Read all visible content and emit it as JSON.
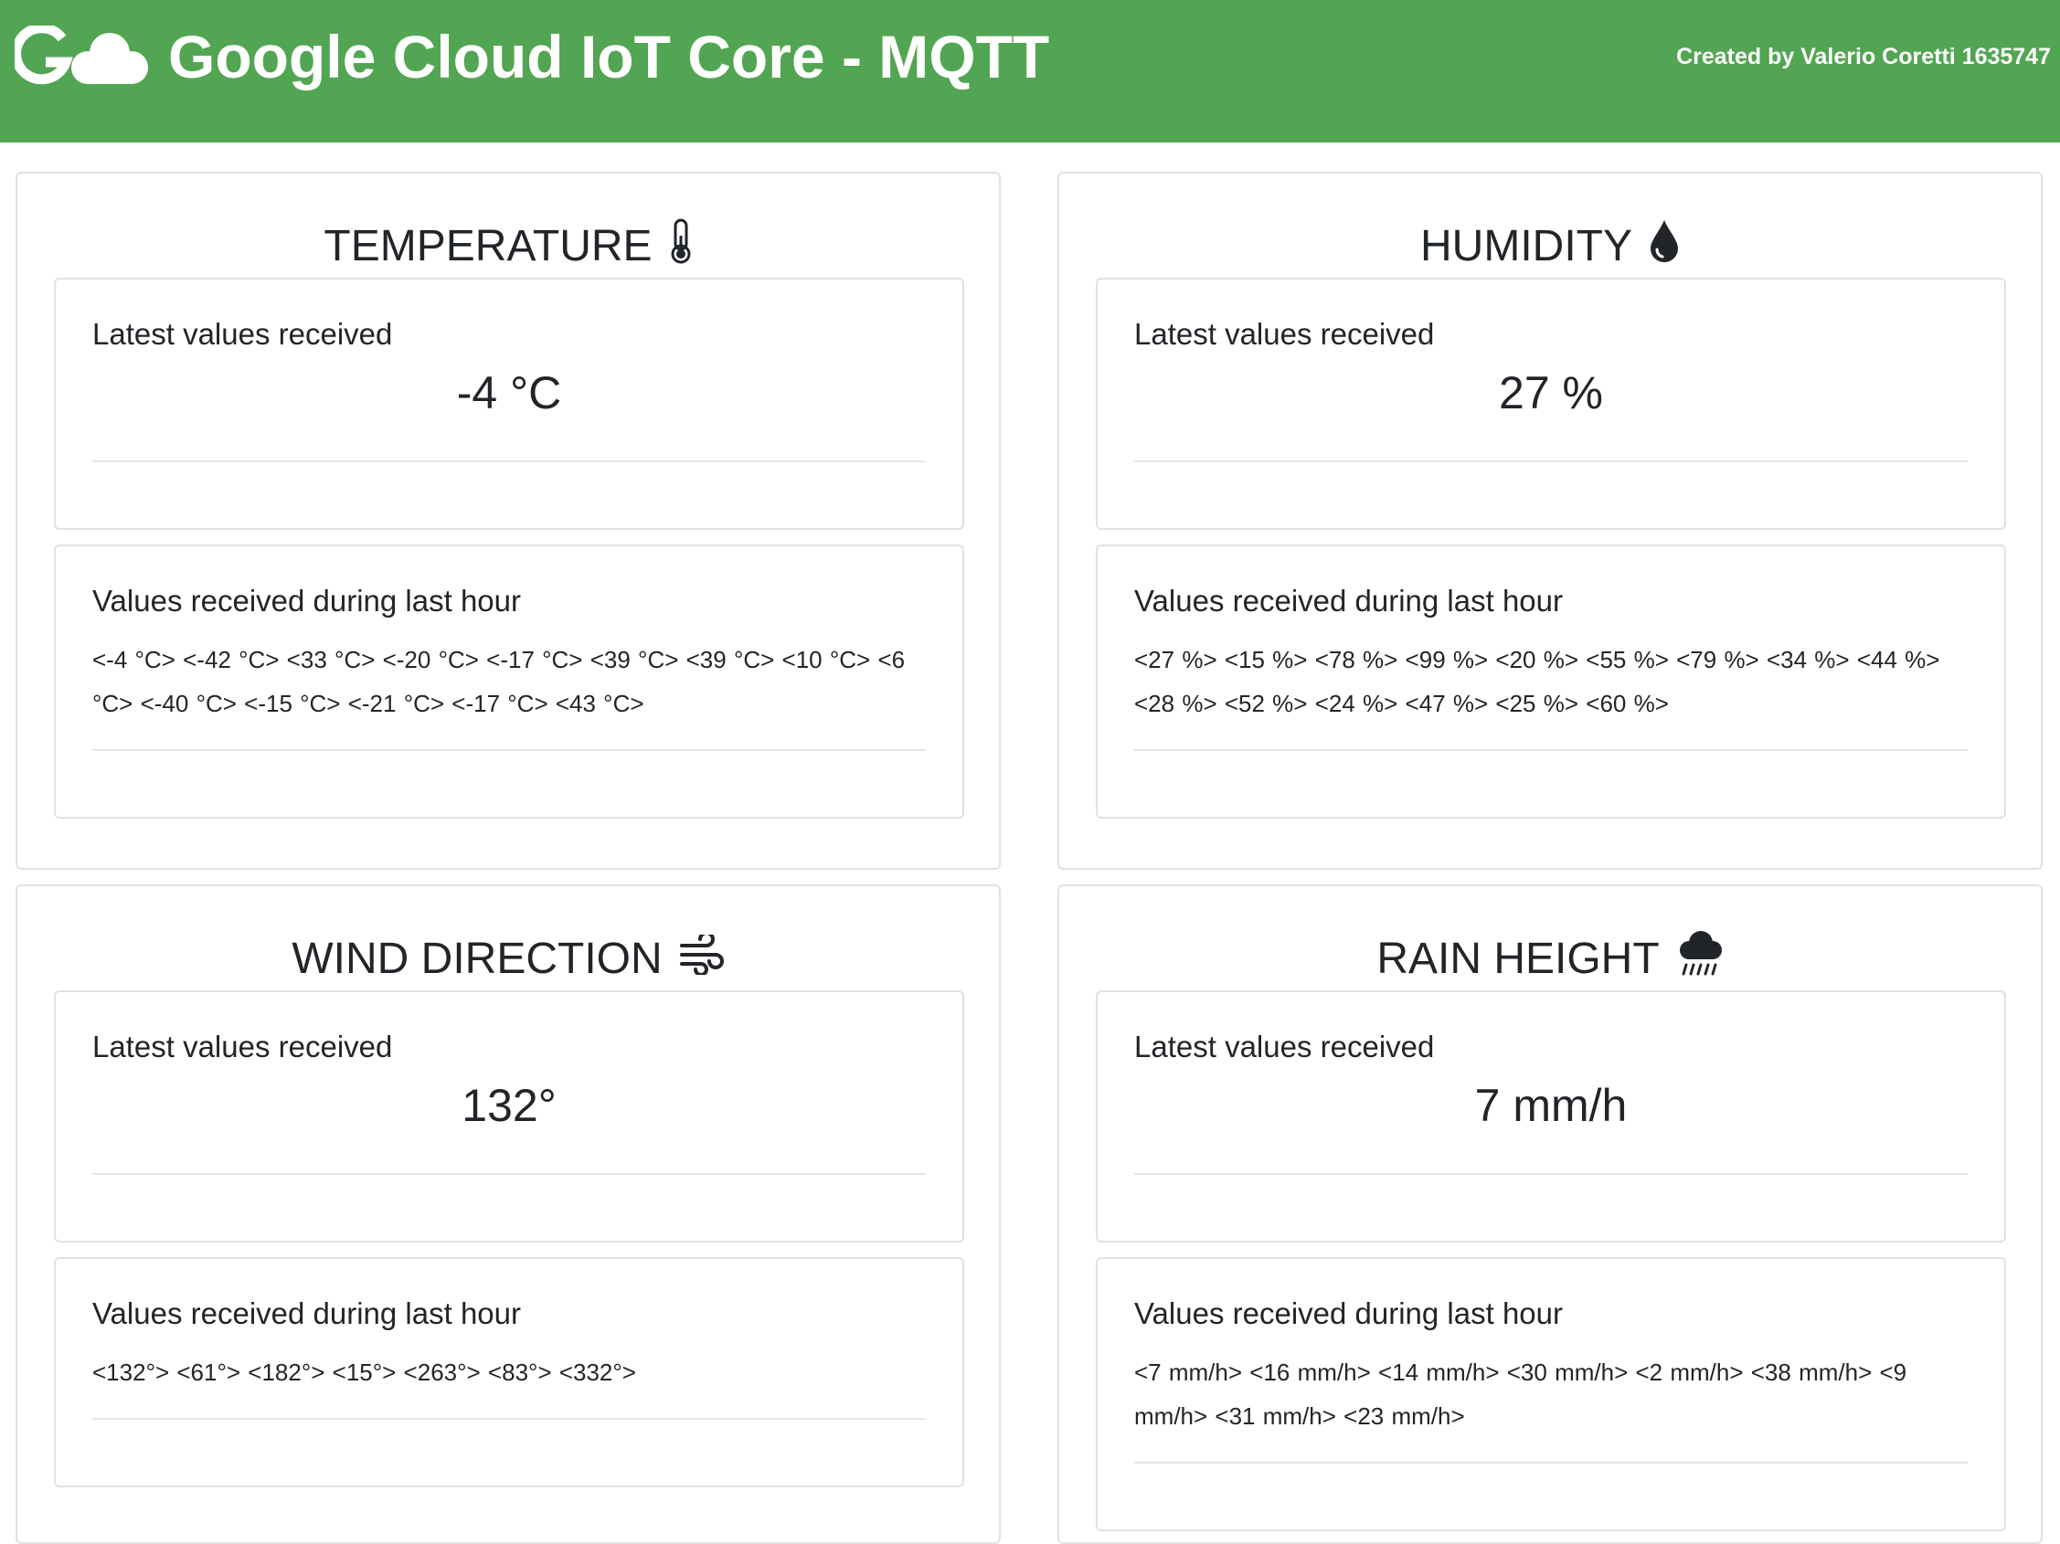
{
  "header": {
    "title": "Google Cloud IoT Core - MQTT",
    "credit": "Created by Valerio Coretti 1635747",
    "color": "#52a552",
    "logo_icon": "google-cloud-logo-icon"
  },
  "panels": {
    "temperature": {
      "title": "TEMPERATURE",
      "icon": "thermometer-icon",
      "latest_label": "Latest values received",
      "latest_value": "-4 °C",
      "history_label": "Values received during last hour",
      "history": "<-4 °C> <-42 °C> <33 °C> <-20 °C> <-17 °C> <39 °C> <39 °C> <10 °C> <6 °C> <-40 °C> <-15 °C> <-21 °C> <-17 °C> <43 °C>"
    },
    "humidity": {
      "title": "HUMIDITY",
      "icon": "water-drop-icon",
      "latest_label": "Latest values received",
      "latest_value": "27 %",
      "history_label": "Values received during last hour",
      "history": "<27 %> <15 %> <78 %> <99 %> <20 %> <55 %> <79 %> <34 %> <44 %> <28 %> <52 %> <24 %> <47 %> <25 %> <60 %>"
    },
    "wind": {
      "title": "WIND DIRECTION",
      "icon": "wind-icon",
      "latest_label": "Latest values received",
      "latest_value": "132°",
      "history_label": "Values received during last hour",
      "history": "<132°> <61°> <182°> <15°> <263°> <83°> <332°>"
    },
    "rain": {
      "title": "RAIN HEIGHT",
      "icon": "cloud-rain-icon",
      "latest_label": "Latest values received",
      "latest_value": "7 mm/h",
      "history_label": "Values received during last hour",
      "history": "<7 mm/h> <16 mm/h> <14 mm/h> <30 mm/h> <2 mm/h> <38 mm/h> <9 mm/h> <31 mm/h> <23 mm/h>"
    }
  }
}
